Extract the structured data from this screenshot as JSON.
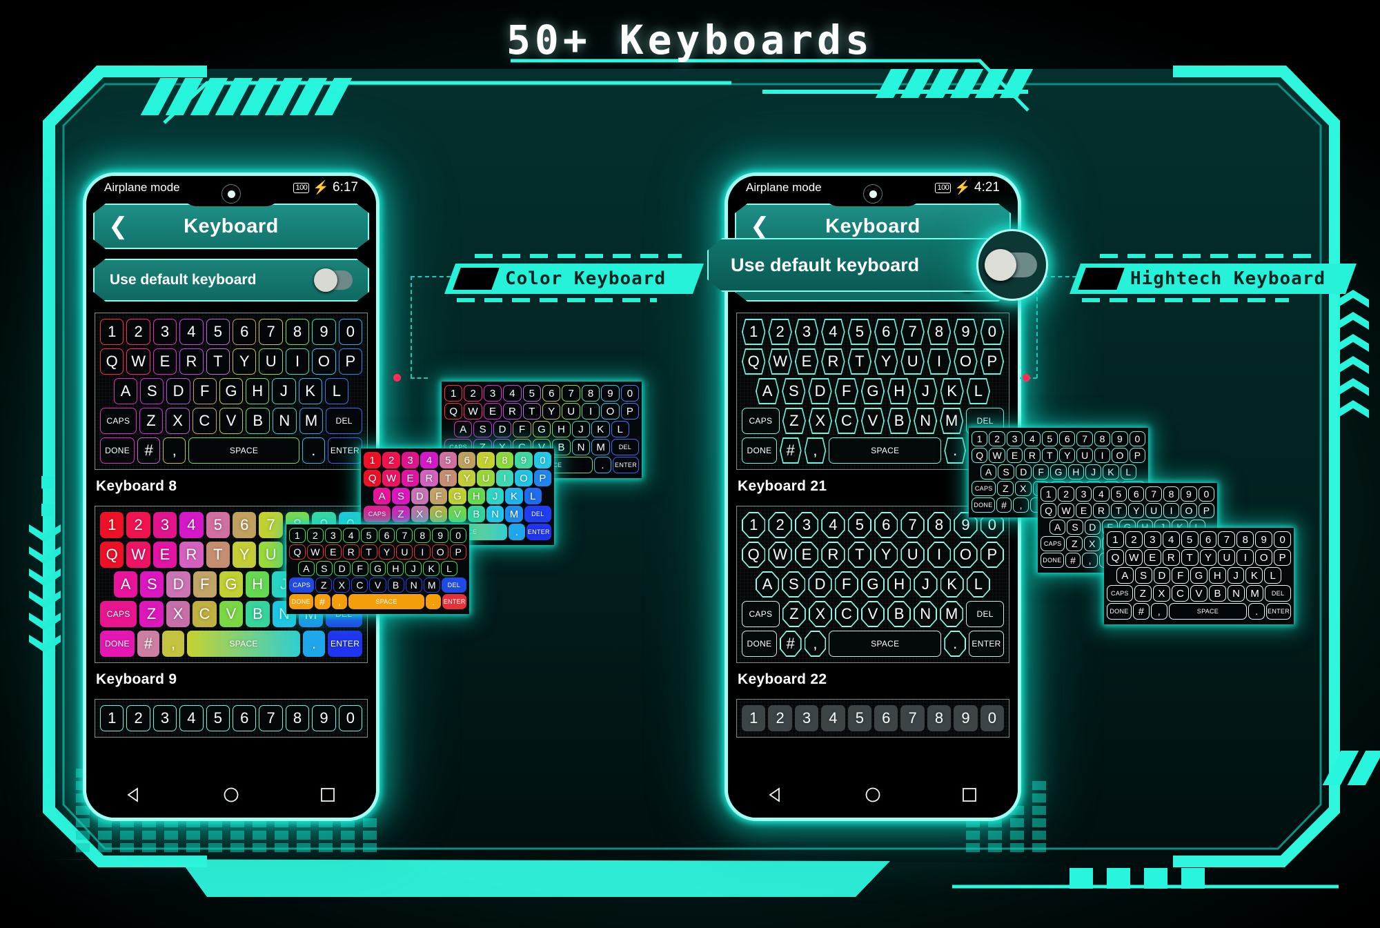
{
  "page": {
    "title": "50+ Keyboards",
    "accent": "#25f2d8",
    "frame_color": "#2ff7de",
    "background": "#021a19"
  },
  "callouts": [
    {
      "id": "color",
      "label": "Color Keyboard"
    },
    {
      "id": "hightech",
      "label": "Hightech Keyboard"
    }
  ],
  "phones": [
    {
      "id": "left",
      "status": {
        "airplane_mode": "Airplane mode",
        "airplane_icon": "airplane-icon",
        "video_icon": "video-camera-icon",
        "battery": "100",
        "charging_icon": "charging-bolt-icon",
        "time": "6:17"
      },
      "appbar": {
        "back_icon": "back-chevron-icon",
        "title": "Keyboard"
      },
      "setting": {
        "label": "Use default keyboard",
        "toggle_state": "off"
      },
      "keyboards": [
        {
          "label": "Keyboard 8",
          "style": "outline-rainbow"
        },
        {
          "label": "Keyboard 9",
          "style": "filled-rainbow"
        },
        {
          "label": "",
          "style": "outline-teal-partial"
        }
      ],
      "nav": {
        "back": "back-triangle-icon",
        "home": "home-circle-icon",
        "recents": "recents-square-icon"
      }
    },
    {
      "id": "right",
      "status": {
        "airplane_mode": "Airplane mode",
        "airplane_icon": "airplane-icon",
        "video_icon": "video-camera-icon",
        "battery": "100",
        "charging_icon": "charging-bolt-icon",
        "time": "4:21"
      },
      "appbar": {
        "back_icon": "back-chevron-icon",
        "title": "Keyboard"
      },
      "setting": {
        "label": "Use default keyboard",
        "toggle_state": "off"
      },
      "keyboards": [
        {
          "label": "Keyboard 21",
          "style": "hexagon-teal"
        },
        {
          "label": "Keyboard 22",
          "style": "octagon-teal"
        },
        {
          "label": "",
          "style": "filled-gray-partial"
        }
      ],
      "nav": {
        "back": "back-triangle-icon",
        "home": "home-circle-icon",
        "recents": "recents-square-icon"
      }
    }
  ],
  "magnifier": {
    "label": "Use default keyboard",
    "toggle_state": "off"
  },
  "keyboard_layout": {
    "rows": [
      [
        "1",
        "2",
        "3",
        "4",
        "5",
        "6",
        "7",
        "8",
        "9",
        "0"
      ],
      [
        "Q",
        "W",
        "E",
        "R",
        "T",
        "Y",
        "U",
        "I",
        "O",
        "P"
      ],
      [
        "A",
        "S",
        "D",
        "F",
        "G",
        "H",
        "J",
        "K",
        "L"
      ],
      [
        "CAPS",
        "Z",
        "X",
        "C",
        "V",
        "B",
        "N",
        "M",
        "DEL"
      ],
      [
        "DONE",
        "#",
        ",",
        "SPACE",
        ".",
        "ENTER"
      ]
    ]
  },
  "palettes": {
    "rainbow": [
      "#ff1f3d",
      "#ff1f78",
      "#ff1fc0",
      "#e81ff0",
      "#d14bd8",
      "#c77a6e",
      "#c9a94f",
      "#b8cf3d",
      "#7fe04a",
      "#3fe59a",
      "#27e0c4",
      "#2ec8e8",
      "#2f9ef0",
      "#2f6ef2"
    ],
    "teal": "#6ef5e0",
    "white": "#e8f6f4"
  }
}
